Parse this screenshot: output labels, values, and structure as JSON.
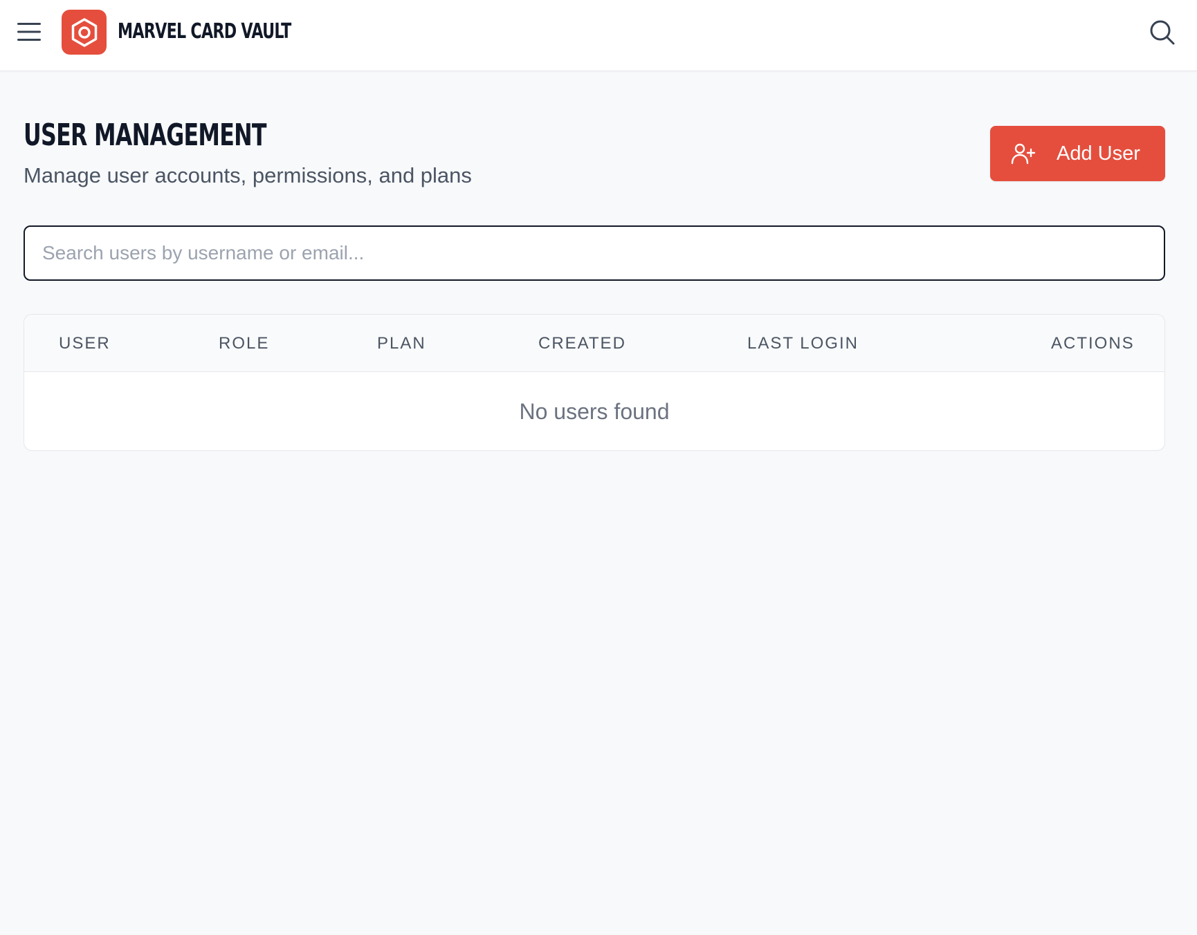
{
  "header": {
    "app_title": "MARVEL CARD VAULT",
    "menu_icon": "hamburger-menu-icon",
    "logo_icon": "hexagon-logo-icon",
    "search_icon": "search-icon"
  },
  "page": {
    "title": "USER MANAGEMENT",
    "subtitle": "Manage user accounts, permissions, and plans",
    "add_user_label": "Add User",
    "add_user_icon": "user-plus-icon"
  },
  "search": {
    "placeholder": "Search users by username or email...",
    "value": ""
  },
  "table": {
    "columns": [
      "USER",
      "ROLE",
      "PLAN",
      "CREATED",
      "LAST LOGIN",
      "ACTIONS"
    ],
    "rows": [],
    "empty_message": "No users found"
  },
  "colors": {
    "accent": "#e54e3d",
    "text_dark": "#111827",
    "text_muted": "#4b5563",
    "background": "#f8f9fb"
  }
}
